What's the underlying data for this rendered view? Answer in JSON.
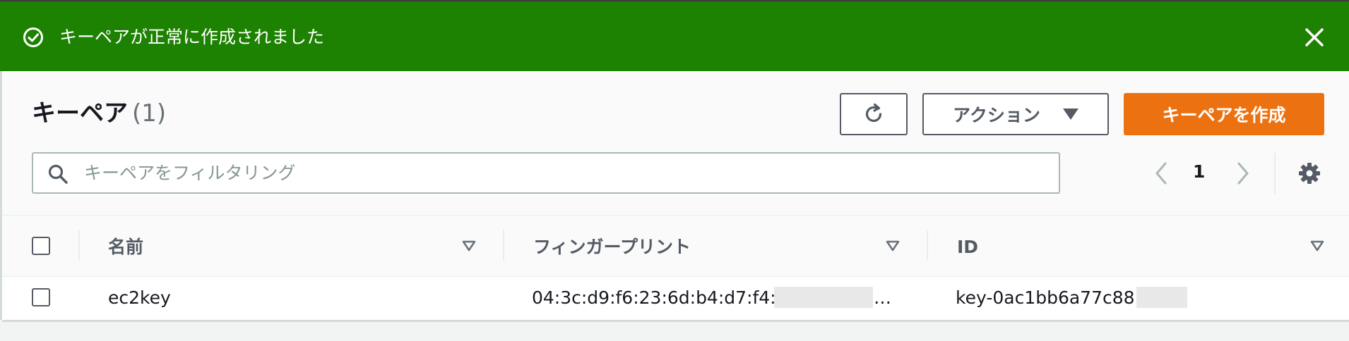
{
  "flash": {
    "message": "キーペアが正常に作成されました",
    "success_color": "#1d8102",
    "icons": {
      "status": "check-circle-icon",
      "dismiss": "close-icon"
    }
  },
  "header": {
    "title": "キーペア",
    "count": "(1)",
    "refresh_icon": "refresh-icon",
    "actions_label": "アクション",
    "create_label": "キーペアを作成",
    "create_color": "#ec7211"
  },
  "filter": {
    "placeholder": "キーペアをフィルタリング",
    "icon": "search-icon"
  },
  "pagination": {
    "current_page": "1",
    "prev_icon": "chevron-left-icon",
    "next_icon": "chevron-right-icon",
    "settings_icon": "gear-icon"
  },
  "table": {
    "columns": [
      "名前",
      "フィンガープリント",
      "ID"
    ],
    "rows": [
      {
        "name": "ec2key",
        "fingerprint": "04:3c:d9:f6:23:6d:b4:d7:f4:",
        "fingerprint_suffix": "…",
        "id": "key-0ac1bb6a77c88"
      }
    ]
  }
}
